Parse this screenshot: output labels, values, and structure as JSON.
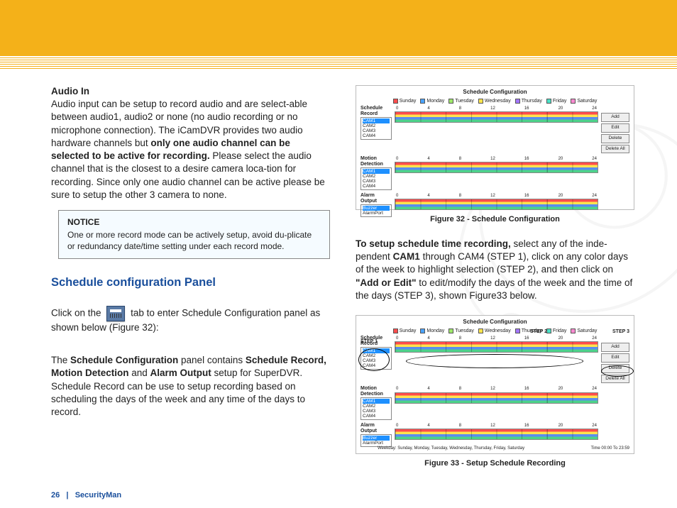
{
  "header": {},
  "left": {
    "h1": "Audio In",
    "p1a": "Audio input can be setup to record audio and are select-able between audio1, audio2 or none (no audio recording or no microphone connection). The iCamDVR provides two audio hardware channels but ",
    "p1bold": "only one audio channel can be selected to be active for recording.",
    "p1b": " Please select the audio channel that is the closest to a desire camera loca-tion for recording. Since only one audio channel can be active please be sure to setup the other 3 camera to none.",
    "notice_title": "NOTICE",
    "notice_body": "One or more record mode can be actively setup, avoid du-plicate or redundancy date/time setting under each record mode.",
    "h2": "Schedule configuration Panel",
    "p2a": "Click on the ",
    "p2b": " tab to enter Schedule Configuration panel as shown below (Figure 32):",
    "p3a": "The ",
    "p3b": "Schedule Configuration",
    "p3c": " panel contains ",
    "p3d": "Schedule Record, Motion Detection",
    "p3e": " and ",
    "p3f": "Alarm Output",
    "p3g": " setup for SuperDVR.  Schedule Record can be use to setup recording based on scheduling the days of the week and any time of the days to record."
  },
  "right": {
    "p1a": "To setup schedule time recording,",
    "p1b": " select any of the inde-pendent ",
    "p1c": "CAM1",
    "p1d": " through CAM4 (STEP 1), click on any color days of the week to highlight selection (STEP 2), and then click on ",
    "p1e": "\"Add or Edit\"",
    "p1f": " to edit/modify the days of the week and the time of the days (STEP 3), shown Figure33 below."
  },
  "figures": {
    "title": "Schedule Configuration",
    "legend": [
      "Sunday",
      "Monday",
      "Tuesday",
      "Wednesday",
      "Thursday",
      "Friday",
      "Saturday"
    ],
    "legend_colors": [
      "#ff4d4d",
      "#4aa3ff",
      "#9fe86b",
      "#ffe44d",
      "#a276ff",
      "#4ae0c6",
      "#ff8ad1"
    ],
    "ticks": [
      "0",
      "4",
      "8",
      "12",
      "16",
      "20",
      "24"
    ],
    "sections": [
      "Schedule Record",
      "Motion Detection",
      "Alarm Output"
    ],
    "cams": [
      "CAM1",
      "CAM2",
      "CAM3",
      "CAM4"
    ],
    "alarm_rows": [
      "Buzzer",
      "AlarmPort"
    ],
    "btns": [
      "Add",
      "Edit",
      "Delete",
      "Delete All"
    ],
    "fig32_caption": "Figure 32 - Schedule Configuration",
    "fig33_caption": "Figure 33 - Setup Schedule Recording",
    "steps": [
      "STEP 1",
      "STEP 2",
      "STEP 3"
    ],
    "fig33_footer_left": "Weekday: Sunday, Monday, Tuesday, Wednesday, Thursday, Friday, Saturday",
    "fig33_footer_right": "Time 00:00 To 23:59"
  },
  "footer": {
    "page": "26",
    "brand": "SecurityMan"
  }
}
